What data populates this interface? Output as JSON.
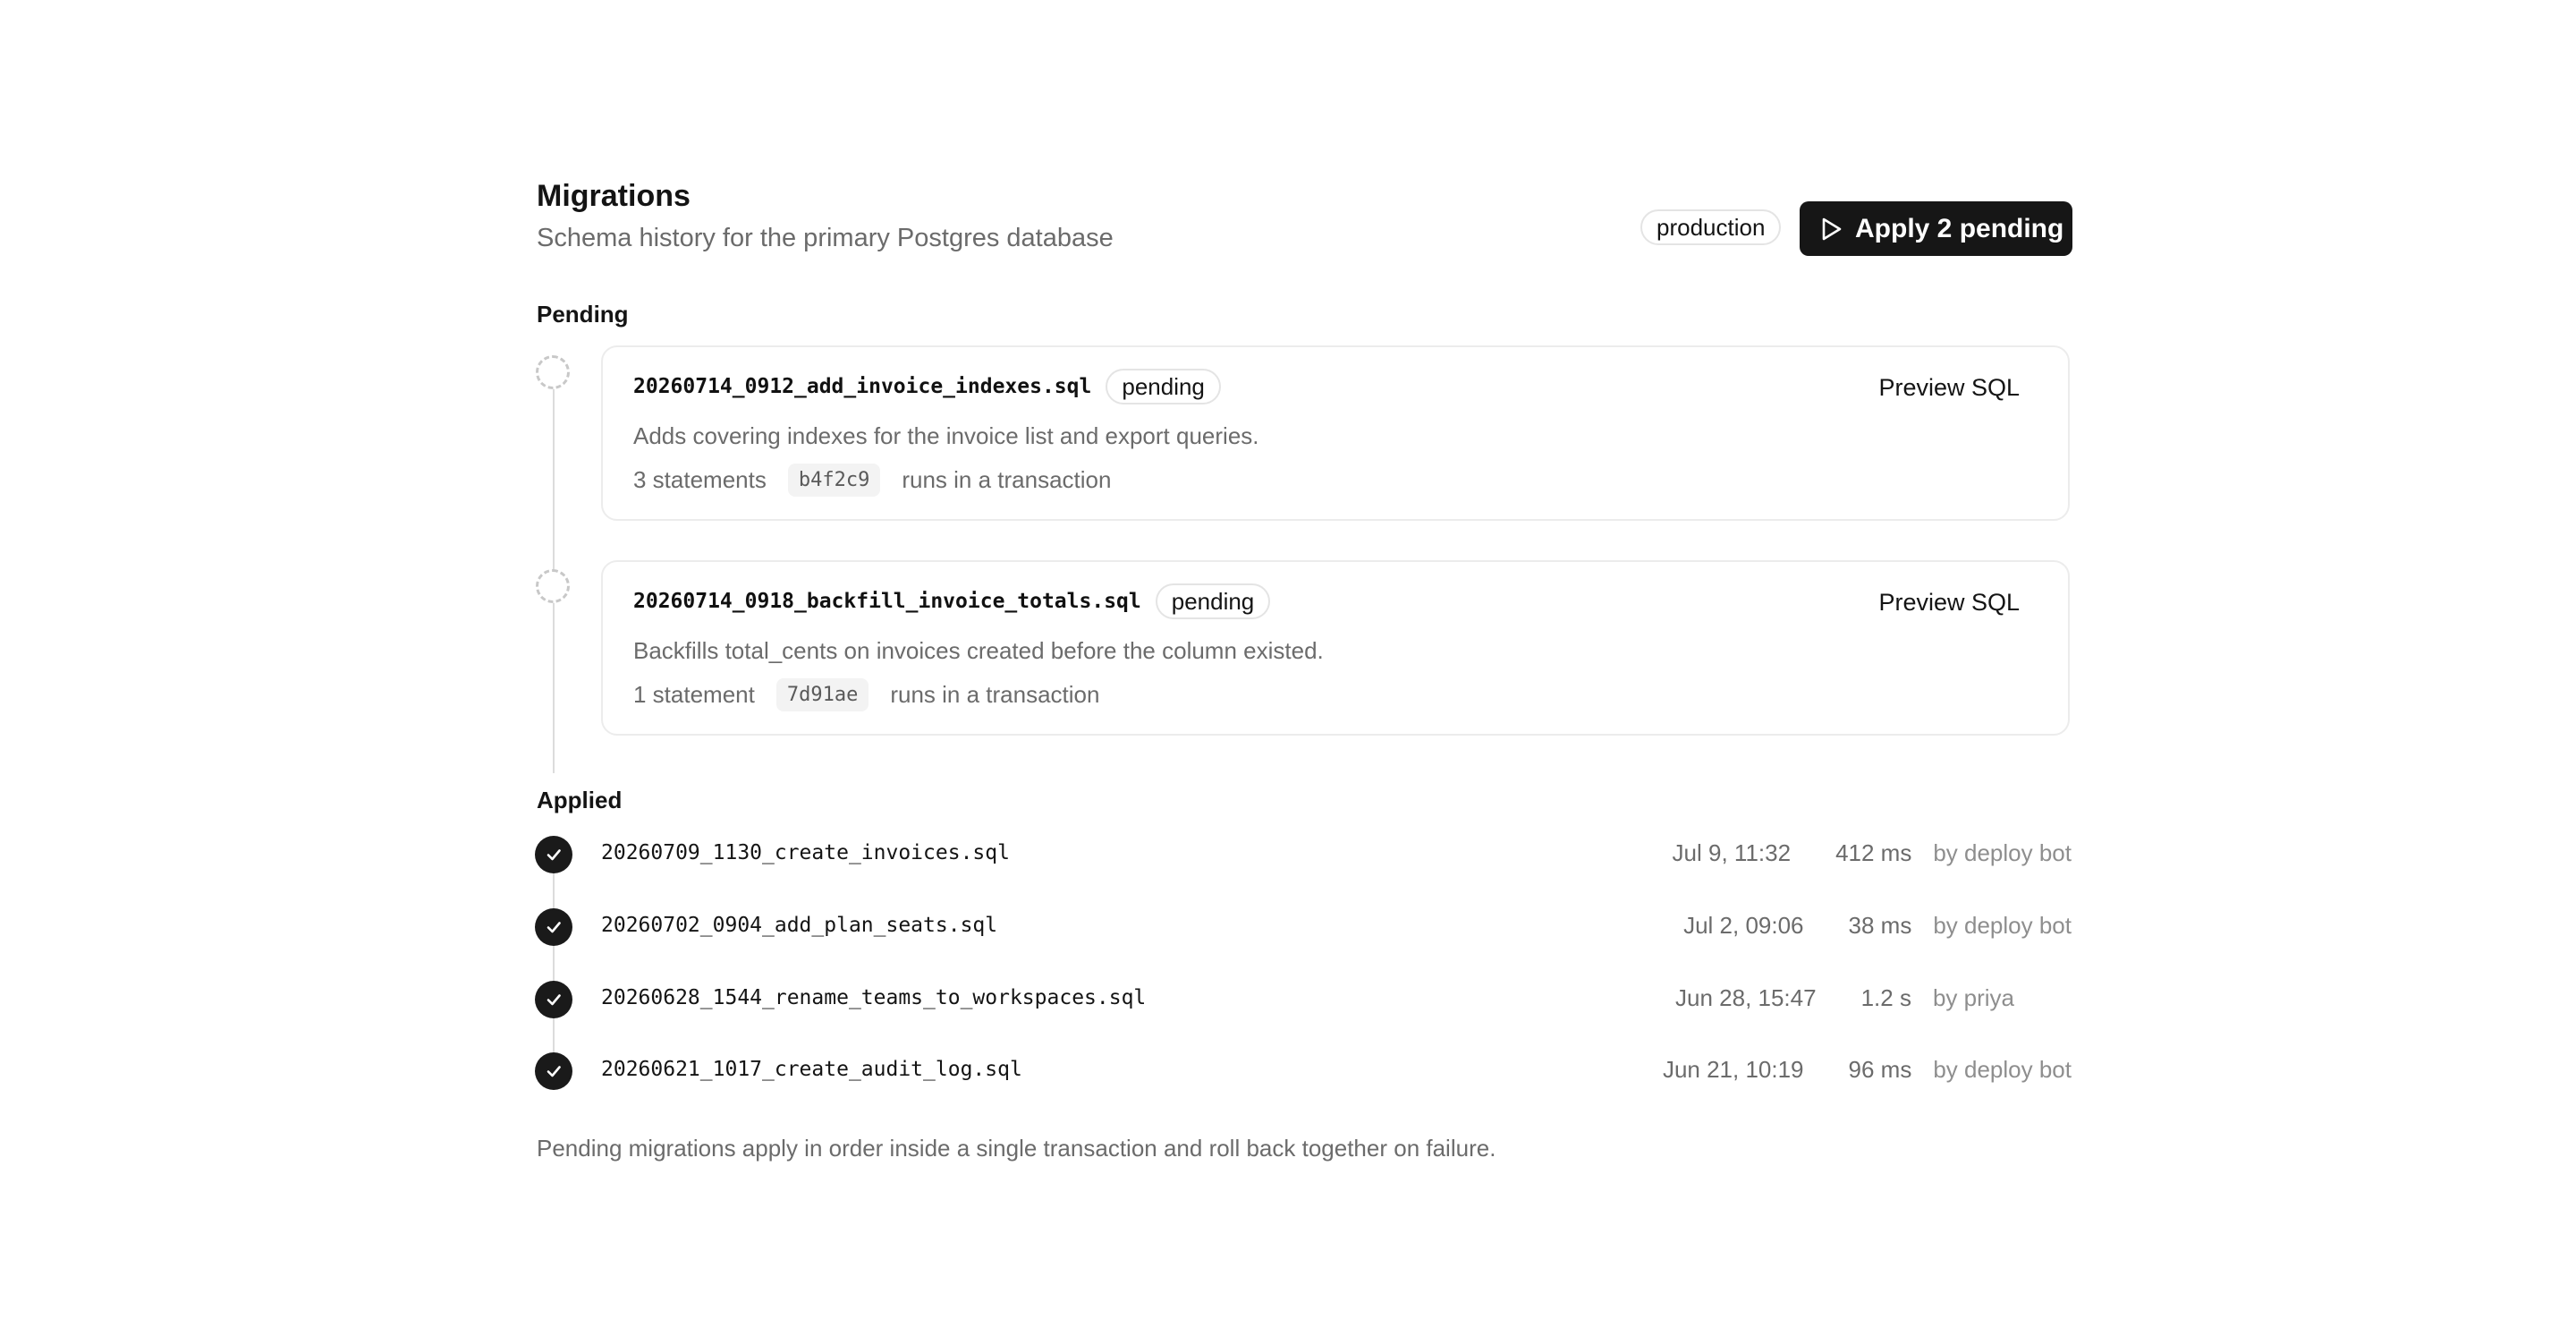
{
  "header": {
    "title": "Migrations",
    "subtitle": "Schema history for the primary Postgres database",
    "environment": "production",
    "apply_label": "Apply 2 pending"
  },
  "pending": {
    "label": "Pending",
    "items": [
      {
        "file": "20260714_0912_add_invoice_indexes.sql",
        "status": "pending",
        "description": "Adds covering indexes for the invoice list and export queries.",
        "statements": "3 statements",
        "hash": "b4f2c9",
        "mode": "runs in a transaction",
        "preview_label": "Preview SQL"
      },
      {
        "file": "20260714_0918_backfill_invoice_totals.sql",
        "status": "pending",
        "description": "Backfills total_cents on invoices created before the column existed.",
        "statements": "1 statement",
        "hash": "7d91ae",
        "mode": "runs in a transaction",
        "preview_label": "Preview SQL"
      }
    ]
  },
  "applied": {
    "label": "Applied",
    "items": [
      {
        "file": "20260709_1130_create_invoices.sql",
        "time": "Jul 9, 11:32",
        "duration": "412 ms",
        "by": "by deploy bot"
      },
      {
        "file": "20260702_0904_add_plan_seats.sql",
        "time": "Jul 2, 09:06",
        "duration": "38 ms",
        "by": "by deploy bot"
      },
      {
        "file": "20260628_1544_rename_teams_to_workspaces.sql",
        "time": "Jun 28, 15:47",
        "duration": "1.2 s",
        "by": "by priya"
      },
      {
        "file": "20260621_1017_create_audit_log.sql",
        "time": "Jun 21, 10:19",
        "duration": "96 ms",
        "by": "by deploy bot"
      }
    ]
  },
  "footer": {
    "note": "Pending migrations apply in order inside a single transaction and roll back together on failure."
  },
  "icons": {
    "apply": "play-icon",
    "pending": "dashed-circle-icon",
    "applied": "check-circle-icon"
  },
  "colors": {
    "primary": "#161616",
    "muted": "#6b6b6b",
    "border": "#ececec"
  }
}
